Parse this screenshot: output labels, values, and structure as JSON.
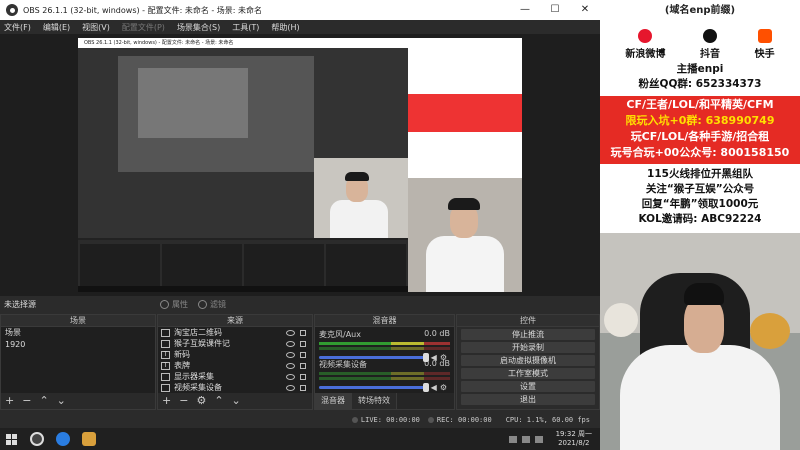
{
  "window": {
    "title": "OBS 26.1.1 (32-bit, windows) - 配置文件: 未命名 - 场景: 未命名",
    "controls": [
      "—",
      "☐",
      "✕"
    ]
  },
  "menu": [
    "文件(F)",
    "编辑(E)",
    "视图(V)",
    "配置文件(P)",
    "场景集合(S)",
    "工具(T)",
    "帮助(H)"
  ],
  "preview": {
    "nested_title": "OBS 26.1.1 (32-bit, windows) - 配置文件: 未命名 - 场景: 未命名"
  },
  "scene_bar": {
    "current": "未选择源",
    "properties": "属性",
    "filters": "滤镜"
  },
  "scenes": {
    "header": "场景",
    "items": [
      "场景",
      "1920"
    ]
  },
  "sources": {
    "header": "来源",
    "items": [
      {
        "label": "淘宝店二维码",
        "icon": "image-icon"
      },
      {
        "label": "猴子互娱课件记",
        "icon": "image-icon"
      },
      {
        "label": "新码",
        "icon": "text-icon"
      },
      {
        "label": "表牌",
        "icon": "text-icon"
      },
      {
        "label": "显示器采集",
        "icon": "monitor-icon"
      },
      {
        "label": "视频采集设备",
        "icon": "camera-icon"
      }
    ]
  },
  "mixer": {
    "header": "混音器",
    "channels": [
      {
        "name": "麦克风/Aux",
        "db": "0.0 dB",
        "level": 0.92
      },
      {
        "name": "视频采集设备",
        "db": "0.0 dB",
        "level": 0.92
      }
    ],
    "tabs": [
      "混音器",
      "转场特效"
    ]
  },
  "controls": {
    "header": "控件",
    "buttons": [
      "停止推流",
      "开始录制",
      "启动虚拟摄像机",
      "工作室模式",
      "设置",
      "退出"
    ]
  },
  "status": {
    "live": "LIVE: 00:00:00",
    "rec": "REC: 00:00:00",
    "cpu": "CPU: 1.1%, 60.00 fps"
  },
  "taskbar": {
    "time": "19:32 周一",
    "date": "2021/8/2"
  },
  "overlay": {
    "top": "(域名enp前缀)",
    "socials": [
      "新浪微博",
      "抖音",
      "快手"
    ],
    "owner": "主播enpi",
    "fans": "粉丝QQ群: 652334373",
    "promo": [
      "CF/王者/LOL/和平精英/CFM",
      "限玩入坑+0群: 638990749",
      "玩CF/LOL/各种手游/招合租",
      "玩号合玩+00公众号: 800158150"
    ],
    "team_title": "115火线排位开黑组队",
    "follow": "关注“猴子互娱”公众号",
    "reply": "回复“年鹏”领取1000元",
    "kol": "KOL邀请码: ABC92224"
  },
  "colors": {
    "overlay_red": "#e52b24",
    "highlight_yellow": "#ffe000",
    "accent_pink": "#e5224a",
    "obs_dark": "#2b2b2b"
  }
}
